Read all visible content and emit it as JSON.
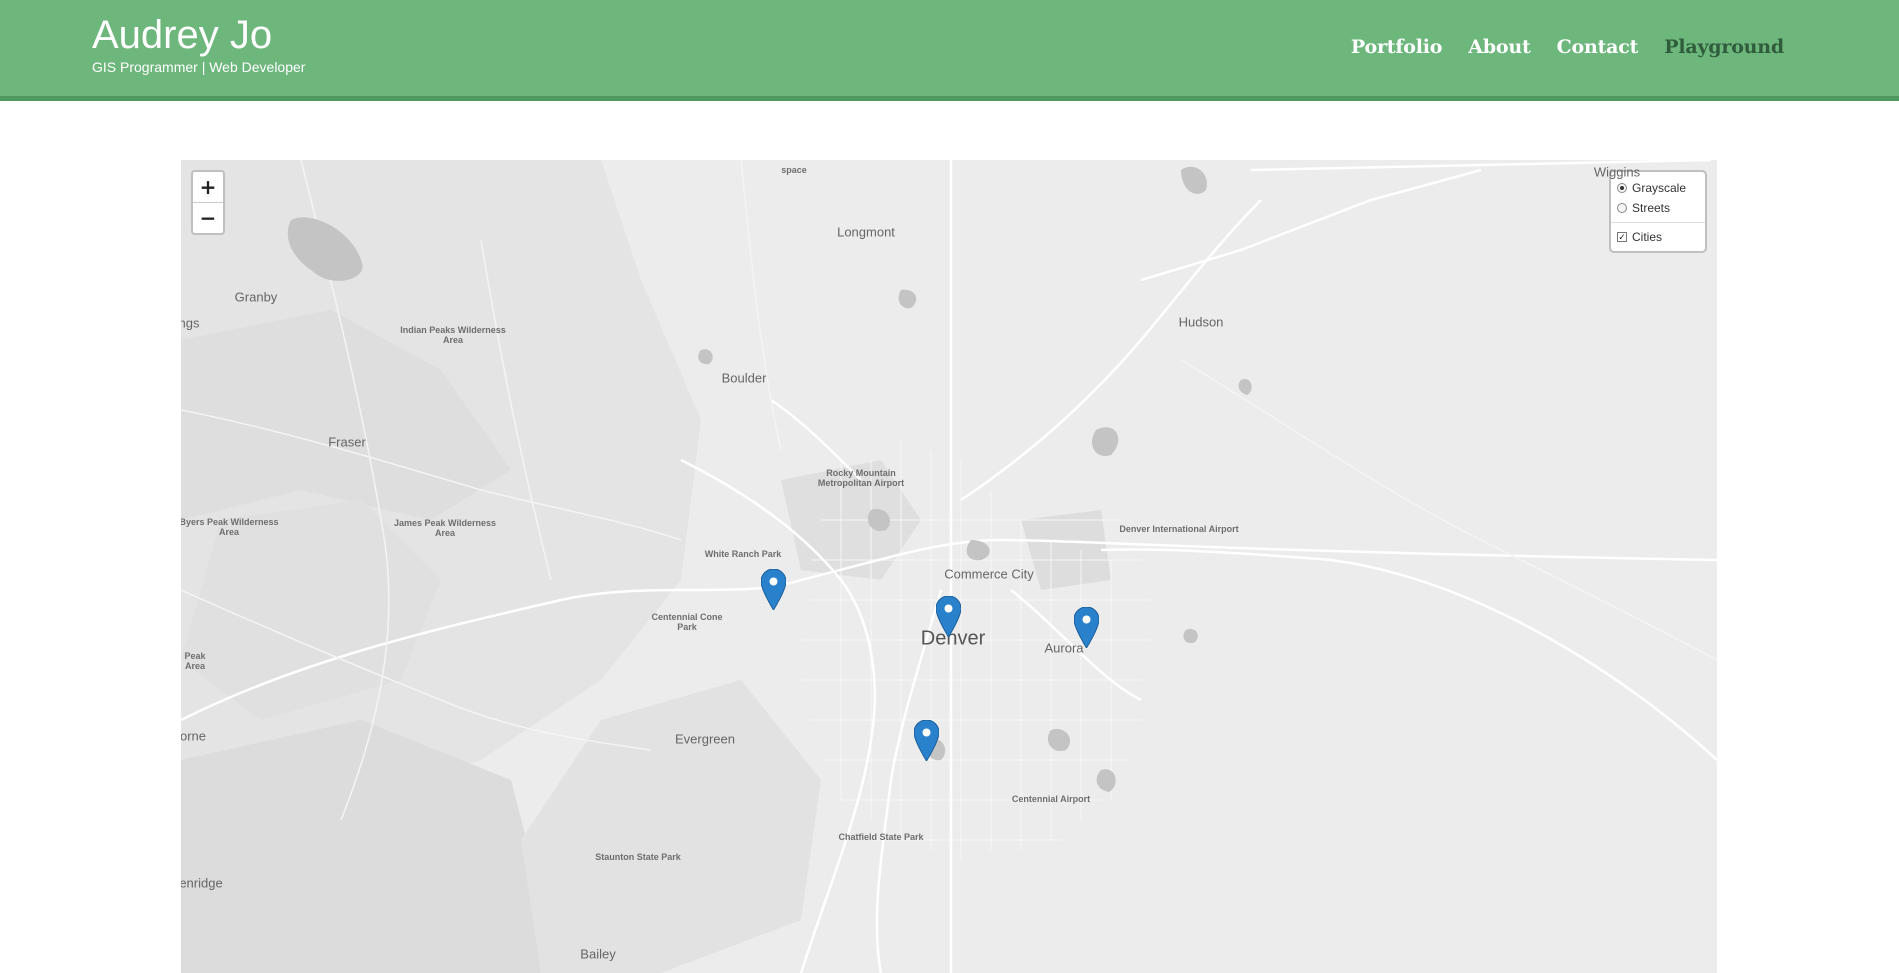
{
  "header": {
    "title": "Audrey Jo",
    "subtitle": "GIS Programmer | Web Developer"
  },
  "nav": {
    "items": [
      "Portfolio",
      "About",
      "Contact",
      "Playground"
    ],
    "active": "Playground"
  },
  "map": {
    "zoom_in": "+",
    "zoom_out": "−",
    "layers": {
      "base": [
        {
          "label": "Grayscale",
          "selected": true
        },
        {
          "label": "Streets",
          "selected": false
        }
      ],
      "overlays": [
        {
          "label": "Cities",
          "checked": true
        }
      ]
    },
    "labels": {
      "wiggins": "Wiggins",
      "longmont": "Longmont",
      "space": "space",
      "granby": "Granby",
      "ngs": "ngs",
      "indian_peaks": "Indian Peaks Wilderness Area",
      "hudson": "Hudson",
      "boulder": "Boulder",
      "fraser": "Fraser",
      "rocky_mountain_airport": "Rocky Mountain Metropolitan Airport",
      "byers_peak": "Byers Peak Wilderness Area",
      "james_peak": "James Peak Wilderness Area",
      "denver_airport": "Denver International Airport",
      "white_ranch": "White Ranch Park",
      "commerce_city": "Commerce City",
      "centennial_cone": "Centennial Cone Park",
      "denver": "Denver",
      "aurora": "Aurora",
      "peak_area": "Peak Area",
      "evergreen": "Evergreen",
      "orne": "orne",
      "centennial_airport": "Centennial Airport",
      "chatfield": "Chatfield State Park",
      "staunton": "Staunton State Park",
      "enridge": "enridge",
      "bailey": "Bailey"
    },
    "marker_color": "#2a81cb",
    "markers": [
      "golden",
      "denver",
      "aurora",
      "littleton"
    ]
  }
}
